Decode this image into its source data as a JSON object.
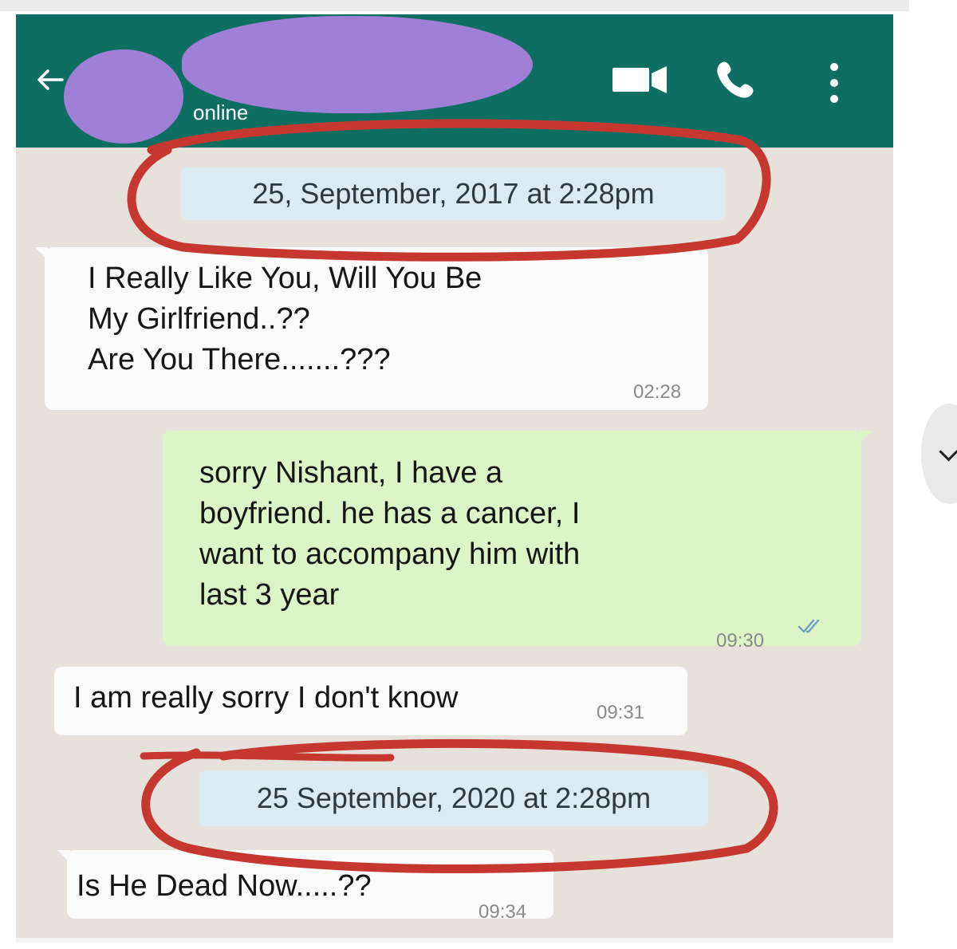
{
  "header": {
    "status": "online",
    "icons": [
      "back-arrow-icon",
      "video-call-icon",
      "phone-call-icon",
      "more-menu-icon"
    ],
    "color": "#0f6e62"
  },
  "messages": [
    {
      "type": "date",
      "text": "25, September,  2017 at 2:28pm"
    },
    {
      "type": "incoming",
      "lines": [
        "I Really Like You, Will You Be",
        "My Girlfriend..??",
        "Are You There.......???"
      ],
      "time": "02:28"
    },
    {
      "type": "outgoing",
      "lines": [
        "sorry Nishant, I have a",
        "boyfriend. he has a cancer, I",
        "want to accompany him with",
        "last 3 year"
      ],
      "time": "09:30"
    },
    {
      "type": "incoming",
      "lines": [
        "I am really sorry I don't know"
      ],
      "time": "09:31"
    },
    {
      "type": "date",
      "text": "25 September, 2020 at 2:28pm"
    },
    {
      "type": "incoming",
      "lines": [
        "Is He Dead Now.....??"
      ],
      "time": "09:34"
    }
  ],
  "colors": {
    "incoming_bubble": "#fbfbfb",
    "outgoing_bubble": "#ddf4c6",
    "date_pill": "#dcebf1",
    "annotation": "#c5372f",
    "redaction": "#a07fd6"
  }
}
